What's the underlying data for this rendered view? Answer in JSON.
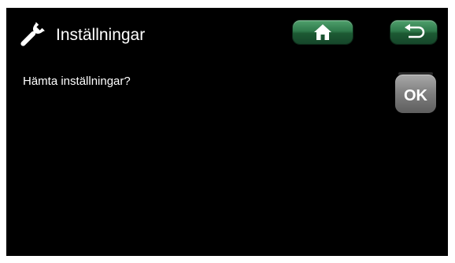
{
  "header": {
    "title": "Inställningar",
    "icon": "wrench-icon",
    "home_icon": "home-icon",
    "back_icon": "back-arrow-icon"
  },
  "main": {
    "question": "Hämta inställningar?",
    "ok_label": "OK"
  },
  "colors": {
    "background": "#000000",
    "nav_button_green": "#2f7a4b",
    "ok_button_gray": "#7e7e7e",
    "text": "#ffffff"
  }
}
